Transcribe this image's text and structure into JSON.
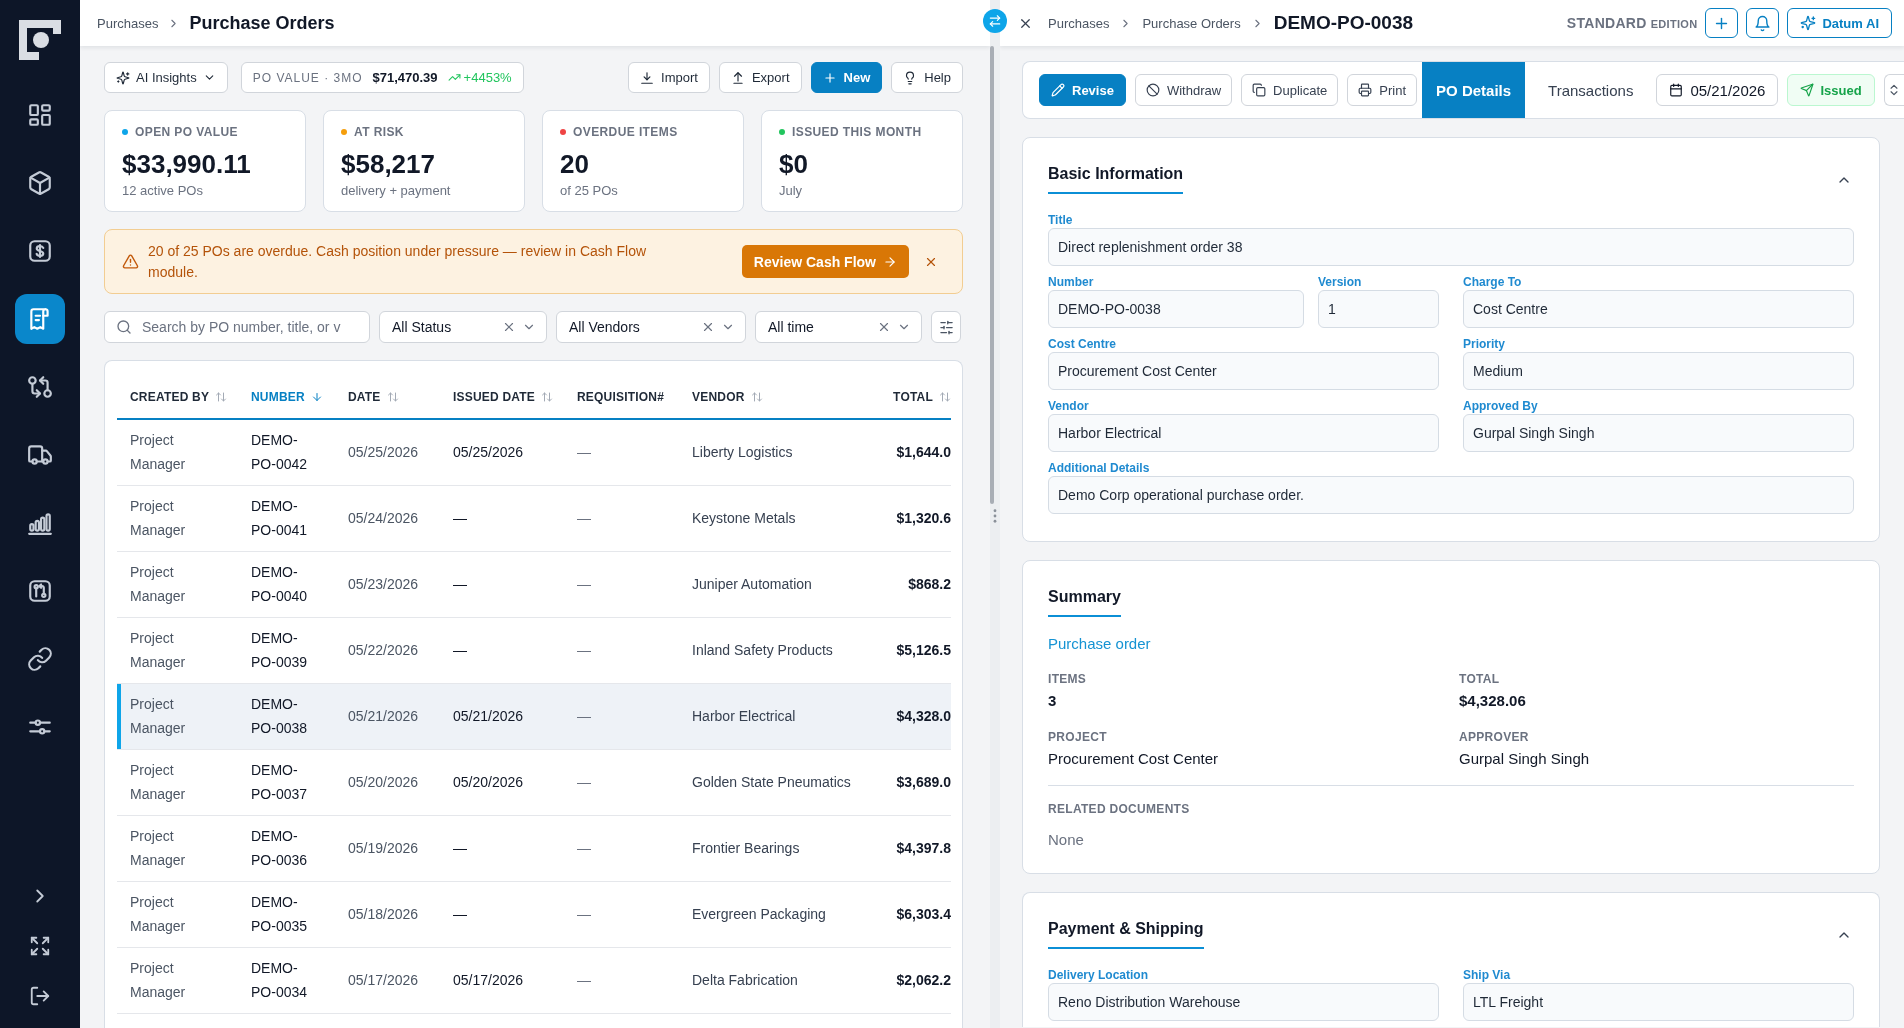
{
  "sidebar": {
    "items": [
      {
        "selected": false
      },
      {
        "selected": false
      },
      {
        "selected": false
      },
      {
        "selected": true
      },
      {
        "selected": false
      },
      {
        "selected": false
      },
      {
        "selected": false
      },
      {
        "selected": false
      },
      {
        "selected": false
      },
      {
        "selected": false
      }
    ]
  },
  "list_pane": {
    "breadcrumb": [
      "Purchases"
    ],
    "title": "Purchase Orders",
    "toolbar": {
      "insights": {
        "label": "AI Insights"
      },
      "po_value": {
        "label": "PO VALUE · 3MO",
        "value": "$71,470.39",
        "trend": "+4453%"
      },
      "buttons": [
        {
          "kind": "default",
          "label": "Import"
        },
        {
          "kind": "default",
          "label": "Export"
        },
        {
          "kind": "primary",
          "label": "New"
        },
        {
          "kind": "default",
          "label": "Help"
        }
      ]
    },
    "kpis": [
      {
        "label": "OPEN PO VALUE",
        "color": "#0ea5e9",
        "value": "$33,990.11",
        "caption": "12 active POs"
      },
      {
        "label": "AT RISK",
        "color": "#f59e0b",
        "value": "$58,217",
        "caption": "delivery + payment"
      },
      {
        "label": "OVERDUE ITEMS",
        "color": "#ef4444",
        "value": "20",
        "caption": "of 25 POs"
      },
      {
        "label": "ISSUED THIS MONTH",
        "color": "#22c55e",
        "value": "$0",
        "caption": "July"
      }
    ],
    "alert": {
      "message": "20 of 25 POs are overdue. Cash position under pressure — review in Cash Flow module.",
      "action": "Review Cash Flow"
    },
    "filters": {
      "search": {
        "placeholder": "Search by PO number, title, or v"
      },
      "dropdowns": [
        {
          "value": "All Status"
        },
        {
          "value": "All Vendors"
        },
        {
          "value": "All time"
        }
      ]
    },
    "table": {
      "columns": [
        {
          "label": "CREATED BY",
          "sortable": true,
          "selected": false
        },
        {
          "label": "NUMBER",
          "sortable": true,
          "selected": true
        },
        {
          "label": "DATE",
          "sortable": true,
          "selected": false
        },
        {
          "label": "ISSUED DATE",
          "sortable": true,
          "selected": false
        },
        {
          "label": "REQUISITION#",
          "sortable": false,
          "selected": false
        },
        {
          "label": "VENDOR",
          "sortable": true,
          "selected": false
        },
        {
          "label": "TOTAL",
          "sortable": true,
          "selected": false
        }
      ],
      "rows": [
        {
          "created_by": "Project Manager",
          "number": "DEMO-PO-0042",
          "date": "05/25/2026",
          "issued_date": "05/25/2026",
          "requisition": "—",
          "vendor": "Liberty Logistics",
          "total": "$1,644.0",
          "selected": false
        },
        {
          "created_by": "Project Manager",
          "number": "DEMO-PO-0041",
          "date": "05/24/2026",
          "issued_date": "—",
          "requisition": "—",
          "vendor": "Keystone Metals",
          "total": "$1,320.6",
          "selected": false
        },
        {
          "created_by": "Project Manager",
          "number": "DEMO-PO-0040",
          "date": "05/23/2026",
          "issued_date": "—",
          "requisition": "—",
          "vendor": "Juniper Automation",
          "total": "$868.2",
          "selected": false
        },
        {
          "created_by": "Project Manager",
          "number": "DEMO-PO-0039",
          "date": "05/22/2026",
          "issued_date": "—",
          "requisition": "—",
          "vendor": "Inland Safety Products",
          "total": "$5,126.5",
          "selected": false
        },
        {
          "created_by": "Project Manager",
          "number": "DEMO-PO-0038",
          "date": "05/21/2026",
          "issued_date": "05/21/2026",
          "requisition": "—",
          "vendor": "Harbor Electrical",
          "total": "$4,328.0",
          "selected": true
        },
        {
          "created_by": "Project Manager",
          "number": "DEMO-PO-0037",
          "date": "05/20/2026",
          "issued_date": "05/20/2026",
          "requisition": "—",
          "vendor": "Golden State Pneumatics",
          "total": "$3,689.0",
          "selected": false
        },
        {
          "created_by": "Project Manager",
          "number": "DEMO-PO-0036",
          "date": "05/19/2026",
          "issued_date": "—",
          "requisition": "—",
          "vendor": "Frontier Bearings",
          "total": "$4,397.8",
          "selected": false
        },
        {
          "created_by": "Project Manager",
          "number": "DEMO-PO-0035",
          "date": "05/18/2026",
          "issued_date": "—",
          "requisition": "—",
          "vendor": "Evergreen Packaging",
          "total": "$6,303.4",
          "selected": false
        },
        {
          "created_by": "Project Manager",
          "number": "DEMO-PO-0034",
          "date": "05/17/2026",
          "issued_date": "05/17/2026",
          "requisition": "—",
          "vendor": "Delta Fabrication",
          "total": "$2,062.2",
          "selected": false
        }
      ]
    }
  },
  "detail_pane": {
    "breadcrumb": [
      "Purchases",
      "Purchase Orders"
    ],
    "title": "DEMO-PO-0038",
    "edition": {
      "name": "STANDARD",
      "label": "EDITION"
    },
    "assistant_button": "Datum AI",
    "actions": [
      {
        "kind": "primary",
        "label": "Revise"
      },
      {
        "kind": "default",
        "label": "Withdraw"
      },
      {
        "kind": "default",
        "label": "Duplicate"
      },
      {
        "kind": "default",
        "label": "Print"
      }
    ],
    "tabs": [
      {
        "label": "PO Details",
        "selected": true
      },
      {
        "label": "Transactions",
        "selected": false
      }
    ],
    "date": "05/21/2026",
    "status": "Issued",
    "basic_information": {
      "title": "Basic Information",
      "expanded": true,
      "fields": [
        {
          "label": "Title",
          "value": "Direct replenishment order 38"
        },
        {
          "label": "Number",
          "value": "DEMO-PO-0038"
        },
        {
          "label": "Version",
          "value": "1"
        },
        {
          "label": "Charge To",
          "value": "Cost Centre"
        },
        {
          "label": "Cost Centre",
          "value": "Procurement Cost Center"
        },
        {
          "label": "Priority",
          "value": "Medium"
        },
        {
          "label": "Vendor",
          "value": "Harbor Electrical"
        },
        {
          "label": "Approved By",
          "value": "Gurpal Singh Singh"
        },
        {
          "label": "Additional Details",
          "value": "Demo Corp operational purchase order."
        }
      ]
    },
    "summary": {
      "title": "Summary",
      "subtitle": "Purchase order",
      "stats": [
        {
          "label": "ITEMS",
          "value": "3"
        },
        {
          "label": "TOTAL",
          "value": "$4,328.06"
        },
        {
          "label": "PROJECT",
          "value": "Procurement Cost Center"
        },
        {
          "label": "APPROVER",
          "value": "Gurpal Singh Singh"
        }
      ],
      "related": {
        "label": "RELATED DOCUMENTS",
        "value": "None"
      }
    },
    "payment_shipping": {
      "title": "Payment & Shipping",
      "expanded": true,
      "fields": [
        {
          "label": "Delivery Location",
          "value": "Reno Distribution Warehouse"
        },
        {
          "label": "Ship Via",
          "value": "LTL Freight"
        }
      ]
    }
  }
}
